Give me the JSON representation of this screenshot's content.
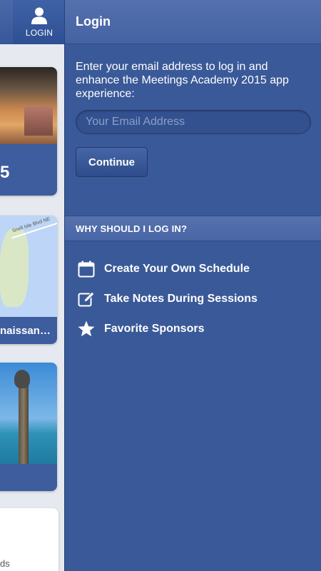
{
  "background_app": {
    "login_tab_label": "LOGIN",
    "hotel_card_number": "5",
    "map_card_title": "naissan…",
    "map_road_label": "Snell Isle Blvd NE",
    "bottom_card_text": "ds"
  },
  "login_panel": {
    "title": "Login",
    "intro": "Enter your email address to log in and enhance the Meetings Academy 2015 app experience:",
    "email_placeholder": "Your Email Address",
    "email_value": "",
    "continue_label": "Continue",
    "why_title": "WHY SHOULD I LOG IN?",
    "benefits": [
      {
        "icon": "calendar-icon",
        "label": "Create Your Own Schedule"
      },
      {
        "icon": "edit-note-icon",
        "label": "Take Notes During Sessions"
      },
      {
        "icon": "star-icon",
        "label": "Favorite Sponsors"
      }
    ]
  },
  "colors": {
    "panel_background": "#3a5998",
    "header_background": "#4562a2",
    "accent_text": "#ffffff"
  }
}
